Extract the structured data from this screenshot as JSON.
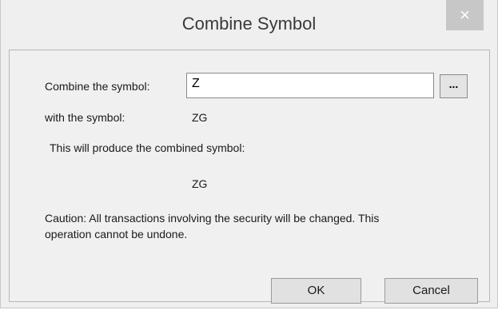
{
  "window": {
    "title": "Combine Symbol",
    "close_glyph": "×"
  },
  "form": {
    "combine_label": "Combine the symbol:",
    "combine_value": "Z",
    "browse_label": "...",
    "with_label": "with the symbol:",
    "with_value": "ZG",
    "produce_label": "This will produce the combined symbol:",
    "result_value": "ZG",
    "caution_text": "Caution:  All transactions involving the security will be changed.  This operation cannot be undone."
  },
  "buttons": {
    "ok_label": "OK",
    "cancel_label": "Cancel"
  },
  "icons": {
    "close": "close-icon",
    "browse": "ellipsis-icon"
  },
  "colors": {
    "window_bg": "#efefef",
    "close_button_bg": "#c7c7c7"
  }
}
